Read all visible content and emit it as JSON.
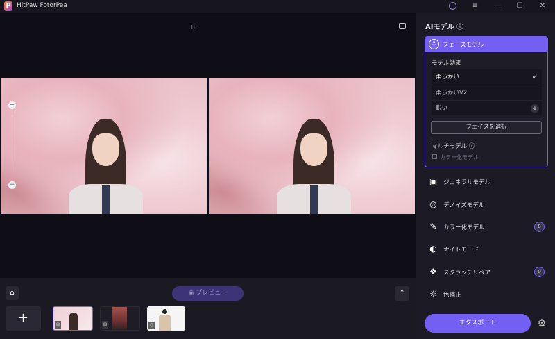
{
  "app": {
    "title": "HitPaw FotorPea",
    "logo_letter": "P"
  },
  "titlebar": {
    "account_icon": "user-circle-icon",
    "menu_icon": "menu-icon",
    "minimize": "—",
    "maximize": "☐",
    "close": "✕"
  },
  "canvas": {
    "crop_icon": "⌗",
    "feedback_icon": "thumbs-down-icon",
    "zoom_in": "+",
    "zoom_out": "−"
  },
  "bottom": {
    "home_icon": "⌂",
    "preview_label": "プレビュー",
    "preview_eye": "◉",
    "collapse_icon": "⌃",
    "add_label": "+",
    "thumb_badge": "☺"
  },
  "panel": {
    "title": "AIモデル",
    "info": "ⓘ",
    "face_model": {
      "label": "フェースモデル",
      "effect_heading": "モデル効果",
      "options": [
        {
          "label": "柔らかい",
          "state": "✓"
        },
        {
          "label": "柔らかいV2",
          "state": ""
        },
        {
          "label": "鋭い",
          "state": "↓"
        }
      ],
      "select_face": "フェイスを選択",
      "multi_model": "マルチモデル",
      "colorize_checkbox": "カラー化モデル"
    },
    "models": [
      {
        "label": "ジェネラルモデル",
        "icon": "▣",
        "count": null
      },
      {
        "label": "デノイズモデル",
        "icon": "◎",
        "count": null
      },
      {
        "label": "カラー化モデル",
        "icon": "✎",
        "count": "8"
      },
      {
        "label": "ナイトモード",
        "icon": "◐",
        "count": null
      },
      {
        "label": "スクラッチリペア",
        "icon": "❖",
        "count": "0"
      },
      {
        "label": "色補正",
        "icon": "☼",
        "count": null
      }
    ],
    "export_label": "エクスポート",
    "settings_icon": "⚙"
  },
  "colors": {
    "accent": "#7360f2",
    "panel": "#1c1b25",
    "canvas": "#0f0e16"
  }
}
